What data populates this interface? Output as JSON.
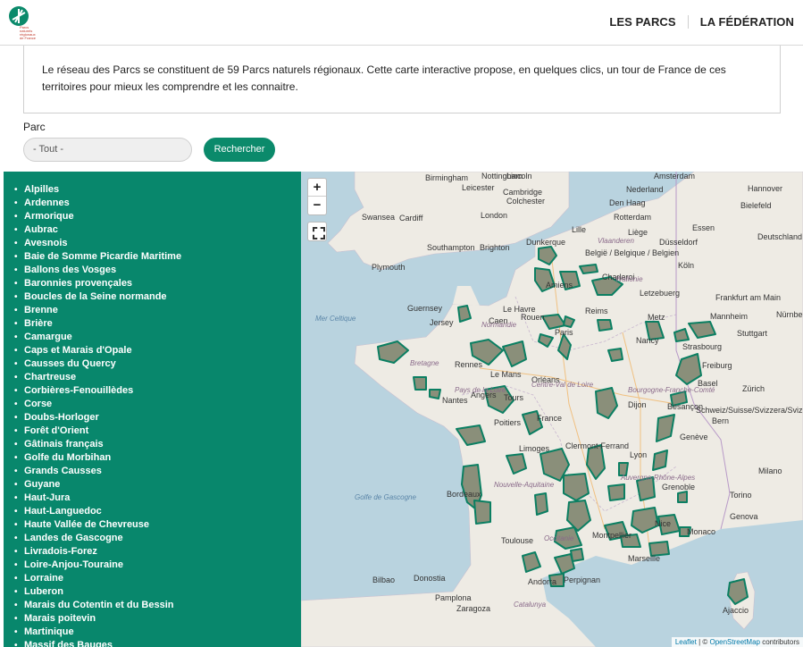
{
  "logo": {
    "text_line1": "Parcs",
    "text_line2": "naturels",
    "text_line3": "régionaux",
    "text_line4": "de France"
  },
  "nav": [
    "LES PARCS",
    "LA FÉDÉRATION"
  ],
  "intro": "Le réseau des Parcs se constituent de 59 Parcs naturels régionaux. Cette carte interactive propose, en quelques clics, un tour de France de ces territoires pour mieux les comprendre et les connaitre.",
  "filter": {
    "label": "Parc",
    "selected": "- Tout -",
    "button": "Rechercher"
  },
  "parks": [
    "Alpilles",
    "Ardennes",
    "Armorique",
    "Aubrac",
    "Avesnois",
    "Baie de Somme Picardie Maritime",
    "Ballons des Vosges",
    "Baronnies provençales",
    "Boucles de la Seine normande",
    "Brenne",
    "Brière",
    "Camargue",
    "Caps et Marais d'Opale",
    "Causses du Quercy",
    "Chartreuse",
    "Corbières-Fenouillèdes",
    "Corse",
    "Doubs-Horloger",
    "Forêt d'Orient",
    "Gâtinais français",
    "Golfe du Morbihan",
    "Grands Causses",
    "Guyane",
    "Haut-Jura",
    "Haut-Languedoc",
    "Haute Vallée de Chevreuse",
    "Landes de Gascogne",
    "Livradois-Forez",
    "Loire-Anjou-Touraine",
    "Lorraine",
    "Luberon",
    "Marais du Cotentin et du Bessin",
    "Marais poitevin",
    "Martinique",
    "Massif des Bauges"
  ],
  "map": {
    "zoom_in": "+",
    "zoom_out": "−",
    "labels": {
      "birmingham": "Birmingham",
      "leicester": "Leicester",
      "nottingham": "Nottingham",
      "lincoln": "Lincoln",
      "cambridge": "Cambridge",
      "cardiff": "Cardiff",
      "london": "London",
      "swansea": "Swansea",
      "southampton": "Southampton",
      "brighton": "Brighton",
      "plymouth": "Plymouth",
      "colchester": "Colchester",
      "amsterdam": "Amsterdam",
      "den_haag": "Den Haag",
      "rotterdam": "Rotterdam",
      "nederland": "Nederland",
      "hannover": "Hannover",
      "bielefeld": "Bielefeld",
      "essen": "Essen",
      "dusseldorf": "Düsseldorf",
      "koln": "Köln",
      "deutschland": "Deutschland",
      "lille": "Lille",
      "dunkerque": "Dunkerque",
      "belgique": "België / Belgique / Belgien",
      "liege": "Liège",
      "charleroi": "Charleroi",
      "vlaanderen": "Vlaanderen",
      "wallonie": "Wallonie",
      "luxembourg": "Letzebuerg",
      "frankfurt": "Frankfurt am Main",
      "mannheim": "Mannheim",
      "nurnberg": "Nürnberg",
      "stuttgart": "Stuttgart",
      "amiens": "Amiens",
      "rouen": "Rouen",
      "le_havre": "Le Havre",
      "caen": "Caen",
      "guernsey": "Guernsey",
      "jersey": "Jersey",
      "normandie": "Normandie",
      "paris": "Paris",
      "reims": "Reims",
      "metz": "Metz",
      "nancy": "Nancy",
      "strasbourg": "Strasbourg",
      "freiburg": "Freiburg",
      "basel": "Basel",
      "zurich": "Zürich",
      "bretagne": "Bretagne",
      "rennes": "Rennes",
      "le_mans": "Le Mans",
      "orleans": "Orléans",
      "tours": "Tours",
      "nantes": "Nantes",
      "angers": "Angers",
      "pays_loire": "Pays de la Loire",
      "centre_val": "Centre-Val de Loire",
      "bourgogne": "Bourgogne-Franche-Comté",
      "dijon": "Dijon",
      "besancon": "Besançon",
      "france": "France",
      "poitiers": "Poitiers",
      "limoges": "Limoges",
      "clermont": "Clermont-Ferrand",
      "lyon": "Lyon",
      "geneve": "Genève",
      "schweiz": "Schweiz/Suisse/Svizzera/Svizra",
      "bern": "Bern",
      "nouvelle_aquitaine": "Nouvelle-Aquitaine",
      "bordeaux": "Bordeaux",
      "auvergne": "Auvergne-Rhône-Alpes",
      "grenoble": "Grenoble",
      "torino": "Torino",
      "milano": "Milano",
      "genova": "Genova",
      "monaco": "Monaco",
      "nice": "Nice",
      "marseille": "Marseille",
      "montpellier": "Montpellier",
      "toulouse": "Toulouse",
      "occitanie": "Occitanie",
      "perpignan": "Perpignan",
      "andorra": "Andorra",
      "bilbao": "Bilbao",
      "donostia": "Donostia",
      "pamplona": "Pamplona",
      "zaragoza": "Zaragoza",
      "catalunya": "Catalunya",
      "ajaccio": "Ajaccio",
      "mer_celtique": "Mer Celtique",
      "golfe": "Golfe de Gascogne"
    }
  },
  "attribution": {
    "leaflet": "Leaflet",
    "sep": " | © ",
    "osm": "OpenStreetMap",
    "suffix": " contributors"
  },
  "colors": {
    "brand": "#0b8a6b",
    "sidebar": "#08876c",
    "park_fill": "#8a8f7a",
    "park_stroke": "#0b7f62",
    "land": "#eeebe4",
    "sea": "#aad3df"
  }
}
